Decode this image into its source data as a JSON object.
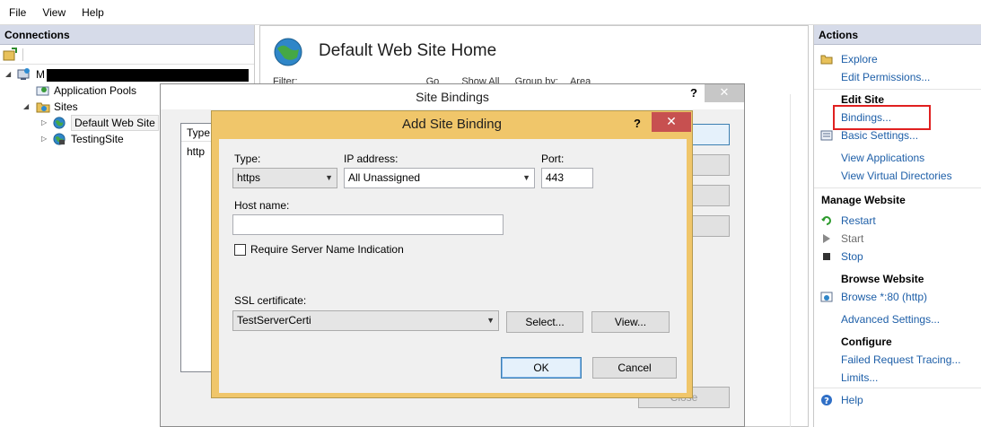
{
  "menu": {
    "file": "File",
    "view": "View",
    "help": "Help"
  },
  "connections": {
    "header": "Connections",
    "tree": {
      "server_prefix": "M",
      "app_pools": "Application Pools",
      "sites": "Sites",
      "default_site": "Default Web Site",
      "testing_site": "TestingSite"
    }
  },
  "home": {
    "title": "Default Web Site Home",
    "filter": "Filter:",
    "go": "Go",
    "show_all": "Show All",
    "group_by": "Group by:",
    "area": "Area"
  },
  "site_bindings": {
    "title": "Site Bindings",
    "help": "?",
    "close": "✕",
    "list_header_type": "Type",
    "list_row_type": "http",
    "close_button": "Close"
  },
  "add_binding": {
    "title": "Add Site Binding",
    "help": "?",
    "close": "✕",
    "type_label": "Type:",
    "type_value": "https",
    "ip_label": "IP address:",
    "ip_value": "All Unassigned",
    "port_label": "Port:",
    "port_value": "443",
    "host_label": "Host name:",
    "host_value": "",
    "sni_label": "Require Server Name Indication",
    "ssl_label": "SSL certificate:",
    "ssl_value": "TestServerCerti",
    "select_button": "Select...",
    "view_button": "View...",
    "ok_button": "OK",
    "cancel_button": "Cancel"
  },
  "actions": {
    "header": "Actions",
    "explore": "Explore",
    "edit_permissions": "Edit Permissions...",
    "edit_site": "Edit Site",
    "bindings": "Bindings...",
    "basic_settings": "Basic Settings...",
    "view_applications": "View Applications",
    "view_virtual_dirs": "View Virtual Directories",
    "manage_website": "Manage Website",
    "restart": "Restart",
    "start": "Start",
    "stop": "Stop",
    "browse_website": "Browse Website",
    "browse_80": "Browse *:80 (http)",
    "advanced_settings": "Advanced Settings...",
    "configure": "Configure",
    "failed_request": "Failed Request Tracing...",
    "limits": "Limits...",
    "help": "Help"
  }
}
